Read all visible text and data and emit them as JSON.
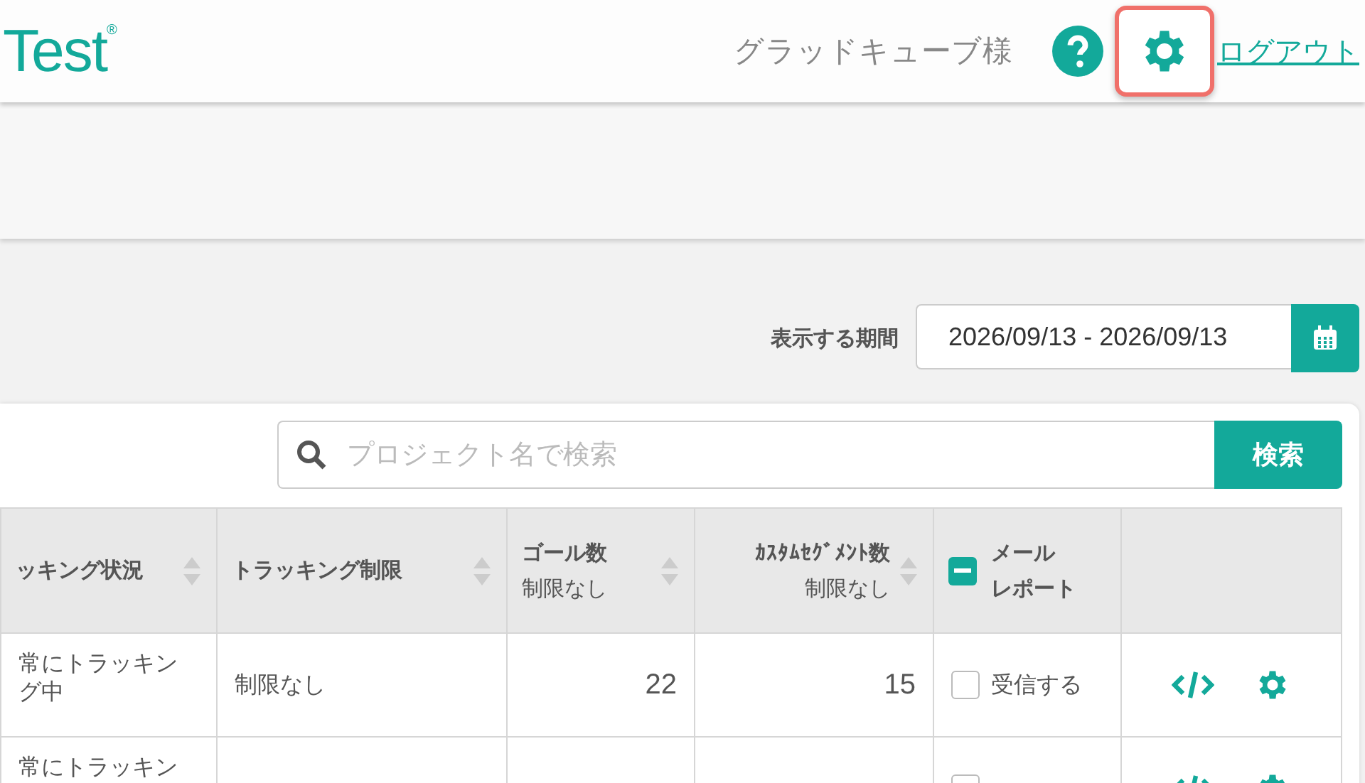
{
  "header": {
    "logo": "Test",
    "logo_mark": "®",
    "user": "グラッドキューブ様",
    "settings_highlighted": true,
    "logout": "ログアウト"
  },
  "period": {
    "label": "表示する期間",
    "value": "2026/09/13 - 2026/09/13"
  },
  "search": {
    "placeholder": "プロジェクト名で検索",
    "button": "検索"
  },
  "table": {
    "columns": [
      {
        "kind": "sort",
        "title": "ッキング状況"
      },
      {
        "kind": "sort",
        "title": "トラッキング制限"
      },
      {
        "kind": "sort",
        "title": "ゴール数",
        "sub": "制限なし"
      },
      {
        "kind": "sort",
        "title": "ｶｽﾀﾑｾｸﾞﾒﾝﾄ数",
        "sub": "制限なし"
      },
      {
        "kind": "check",
        "title": "メール",
        "title2": "レポート",
        "indeterminate": true
      },
      {
        "kind": "actions"
      }
    ],
    "rows": [
      {
        "status": "常にトラッキング中",
        "limit": "制限なし",
        "goals": "22",
        "segments": "15",
        "mail": {
          "label": "受信する",
          "checked": false
        }
      },
      {
        "status": "常にトラッキン",
        "mail": {
          "checked": false
        }
      }
    ]
  }
}
